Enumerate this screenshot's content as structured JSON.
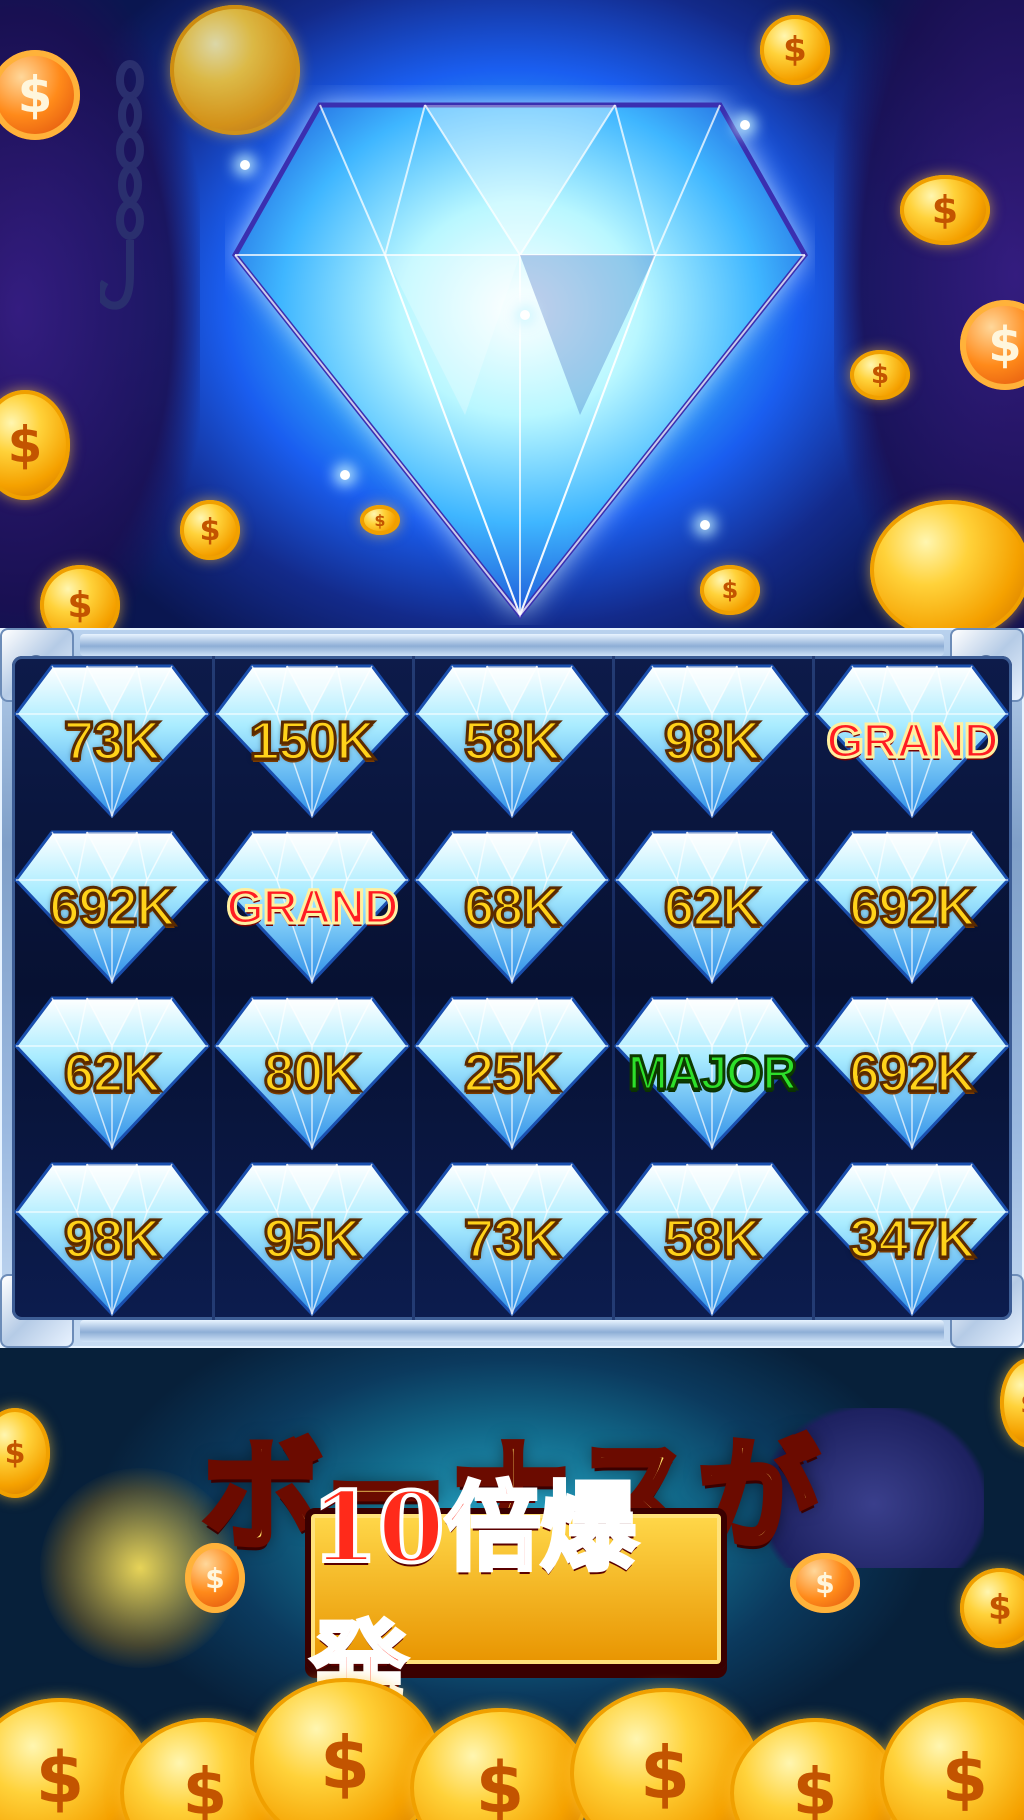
{
  "hero": {
    "background_accent": "#37c8ff",
    "diamond_color": "#9ff0ff",
    "coin_symbol": "$"
  },
  "reels": {
    "rows": [
      [
        {
          "value": "73K",
          "kind": "amount"
        },
        {
          "value": "150K",
          "kind": "amount"
        },
        {
          "value": "58K",
          "kind": "amount"
        },
        {
          "value": "98K",
          "kind": "amount"
        },
        {
          "value": "GRAND",
          "kind": "grand"
        }
      ],
      [
        {
          "value": "692K",
          "kind": "amount"
        },
        {
          "value": "GRAND",
          "kind": "grand"
        },
        {
          "value": "68K",
          "kind": "amount"
        },
        {
          "value": "62K",
          "kind": "amount"
        },
        {
          "value": "692K",
          "kind": "amount"
        }
      ],
      [
        {
          "value": "62K",
          "kind": "amount"
        },
        {
          "value": "80K",
          "kind": "amount"
        },
        {
          "value": "25K",
          "kind": "amount"
        },
        {
          "value": "MAJOR",
          "kind": "major"
        },
        {
          "value": "692K",
          "kind": "amount"
        }
      ],
      [
        {
          "value": "98K",
          "kind": "amount"
        },
        {
          "value": "95K",
          "kind": "amount"
        },
        {
          "value": "73K",
          "kind": "amount"
        },
        {
          "value": "58K",
          "kind": "amount"
        },
        {
          "value": "347K",
          "kind": "amount"
        }
      ]
    ]
  },
  "promo": {
    "line1": "ボーナスが",
    "line2": "10倍爆発"
  },
  "colors": {
    "amount_text": "#ffd21a",
    "grand_text": "#ff1c22",
    "major_text": "#2de02a"
  }
}
